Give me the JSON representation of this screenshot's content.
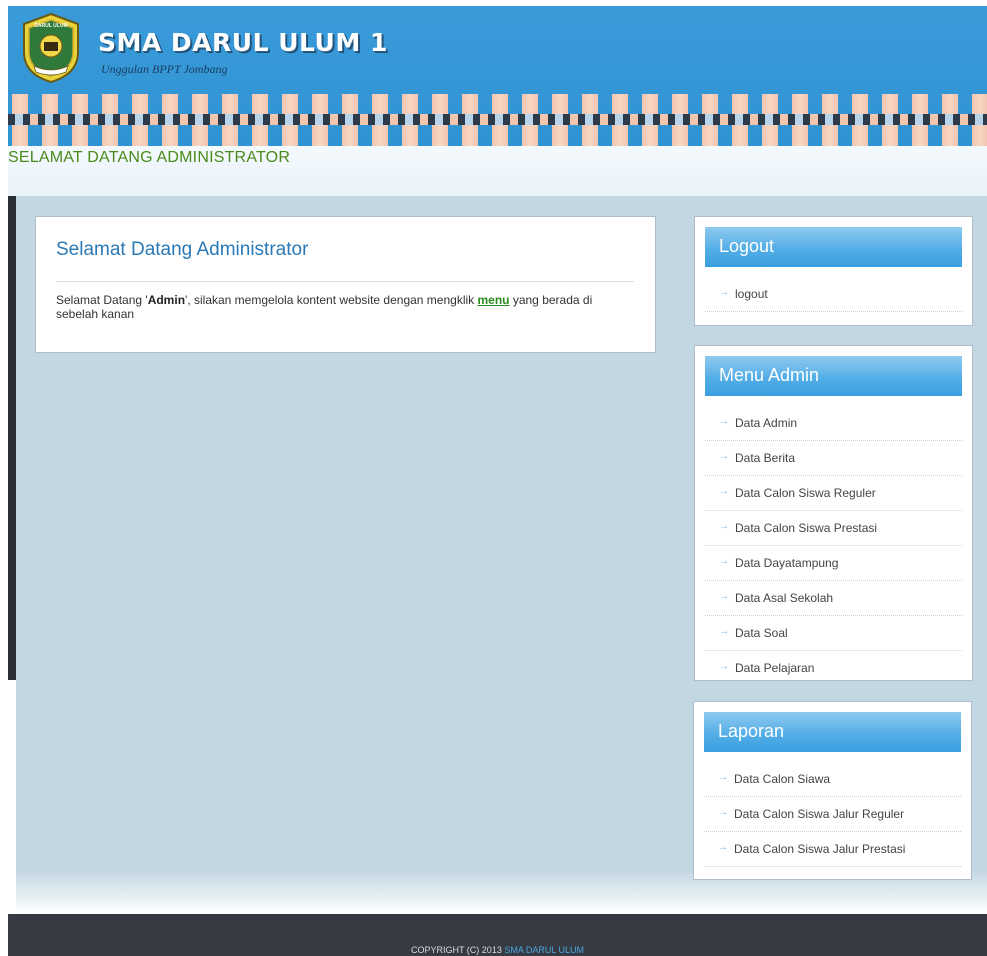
{
  "header": {
    "site_title": "SMA DARUL ULUM 1",
    "tagline": "Unggulan BPPT Jombang",
    "logo_icon": "school-crest-icon",
    "logo_text": "DARUL ULUM"
  },
  "welcome_strip": {
    "text": "SELAMAT DATANG ADMINISTRATOR"
  },
  "content": {
    "title": "Selamat Datang Administrator",
    "body_prefix": "Selamat Datang '",
    "body_user": "Admin",
    "body_middle": "', silakan memgelola kontent website dengan mengklik ",
    "body_link": "menu",
    "body_suffix": " yang berada di sebelah kanan"
  },
  "sidebar": {
    "logout": {
      "title": "Logout",
      "items": [
        {
          "label": "logout"
        }
      ]
    },
    "admin": {
      "title": "Menu Admin",
      "items": [
        {
          "label": "Data Admin"
        },
        {
          "label": "Data Berita"
        },
        {
          "label": "Data Calon Siswa Reguler"
        },
        {
          "label": "Data Calon Siswa Prestasi"
        },
        {
          "label": "Data Dayatampung"
        },
        {
          "label": "Data Asal Sekolah"
        },
        {
          "label": "Data Soal"
        },
        {
          "label": "Data Pelajaran"
        }
      ]
    },
    "laporan": {
      "title": "Laporan",
      "items": [
        {
          "label": "Data Calon Siawa"
        },
        {
          "label": "Data Calon Siswa Jalur Reguler"
        },
        {
          "label": "Data Calon Siswa Jalur Prestasi"
        }
      ]
    },
    "item_icon": "arrow-right-icon"
  },
  "footer": {
    "copyright": "COPYRIGHT (C) 2013",
    "brand": "SMA DARUL ULUM"
  },
  "colors": {
    "header_blue": "#3a9bd9",
    "panel_head_blue": "#54aee6",
    "welcome_green": "#4a8a1a",
    "body_bg": "#c3d7e3",
    "footer_bg": "#353a43"
  }
}
